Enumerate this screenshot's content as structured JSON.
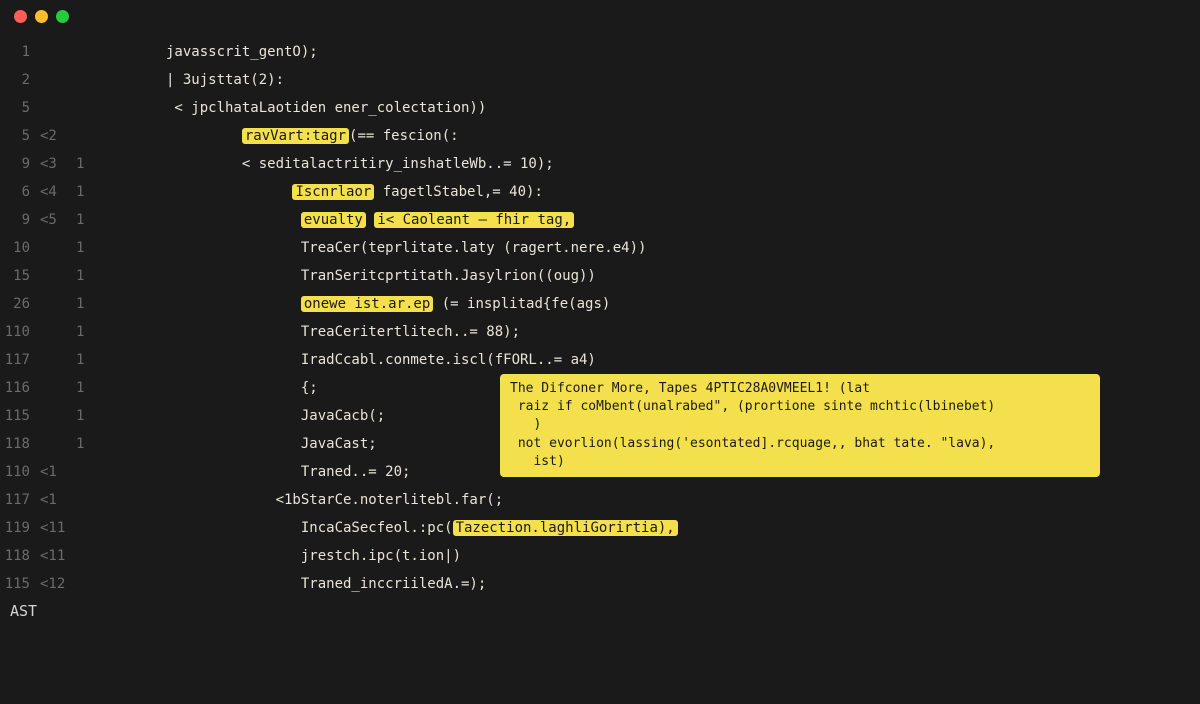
{
  "titlebar": {
    "buttons": [
      "close",
      "minimize",
      "zoom"
    ]
  },
  "lines": [
    {
      "ln": "1",
      "g2": "",
      "g3": "",
      "segs": [
        {
          "t": "javasscrit_gentO);"
        }
      ]
    },
    {
      "ln": "2",
      "g2": "",
      "g3": "",
      "segs": [
        {
          "t": "| "
        },
        {
          "t": "3ujsttat(2):"
        }
      ],
      "cursor": true
    },
    {
      "ln": "5",
      "g2": "",
      "g3": "",
      "segs": [
        {
          "t": " < jpclhataLaotiden ener_colectation))"
        }
      ]
    },
    {
      "ln": "5",
      "g2": "<2",
      "g3": "",
      "segs": [
        {
          "t": "         "
        },
        {
          "t": "ravVart:tagr",
          "hl": true
        },
        {
          "t": "(== fescion(:"
        }
      ]
    },
    {
      "ln": "9",
      "g2": "<3",
      "g3": "1",
      "segs": [
        {
          "t": "         < seditalactritiry_inshatleWb..= 10);"
        }
      ]
    },
    {
      "ln": "6",
      "g2": "<4",
      "g3": "1",
      "segs": [
        {
          "t": "               "
        },
        {
          "t": "Iscnrlaor",
          "hl": true
        },
        {
          "t": " fagetlStabel,= 40):"
        }
      ]
    },
    {
      "ln": "9",
      "g2": "<5",
      "g3": "1",
      "segs": [
        {
          "t": "                "
        },
        {
          "t": "evualty",
          "hl": true
        },
        {
          "t": " "
        },
        {
          "t": "i< Caoleant — fhir tag,",
          "hl": true
        }
      ]
    },
    {
      "ln": "10",
      "g2": "",
      "g3": "1",
      "segs": [
        {
          "t": "                TreaCer(teprlitate.laty (ragert.nere.e4))"
        }
      ]
    },
    {
      "ln": "15",
      "g2": "",
      "g3": "1",
      "segs": [
        {
          "t": "                TranSeritcprtitath.Jasylrion((oug))"
        }
      ]
    },
    {
      "ln": "26",
      "g2": "",
      "g3": "1",
      "segs": [
        {
          "t": "                "
        },
        {
          "t": "onewe ist.ar.ep",
          "hl": true
        },
        {
          "t": " (= insplitad{fe(ags)"
        }
      ]
    },
    {
      "ln": "110",
      "g2": "",
      "g3": "1",
      "segs": [
        {
          "t": "                TreaCeritertlitech..= 88);"
        }
      ]
    },
    {
      "ln": "117",
      "g2": "",
      "g3": "1",
      "segs": [
        {
          "t": "                IradCcabl.conmete.iscl(fFORL..= a4)"
        }
      ]
    },
    {
      "ln": "116",
      "g2": "",
      "g3": "1",
      "segs": [
        {
          "t": "                {;"
        }
      ]
    },
    {
      "ln": "115",
      "g2": "",
      "g3": "1",
      "segs": [
        {
          "t": "                JavaCacb(;"
        }
      ]
    },
    {
      "ln": "118",
      "g2": "",
      "g3": "1",
      "segs": [
        {
          "t": "                JavaCast;"
        }
      ]
    },
    {
      "ln": "110",
      "g2": "<1",
      "g3": "",
      "segs": [
        {
          "t": "                Traned..= 20;"
        }
      ]
    },
    {
      "ln": "117",
      "g2": "<1",
      "g3": "",
      "segs": [
        {
          "t": "             <1bStarCe.noterlitebl.far(;"
        }
      ]
    },
    {
      "ln": "119",
      "g2": "<11",
      "g3": "",
      "segs": [
        {
          "t": "                IncaCaSecfeol.:pc("
        },
        {
          "t": "Tazection.laghliGorirtia),",
          "hl": true
        }
      ]
    },
    {
      "ln": "118",
      "g2": "<11",
      "g3": "",
      "segs": [
        {
          "t": "                jrestch.ipc(t.ion|)"
        }
      ]
    },
    {
      "ln": "115",
      "g2": "<12",
      "g3": "",
      "segs": [
        {
          "t": "                Traned_inccriiledA.=);"
        }
      ]
    }
  ],
  "tooltip": {
    "line1": "The Difconer More, Tapes 4PTIC28A0VMEEL1! (lat",
    "line2": " raiz if coMbent(unalrabed\", (prortione sinte mchtic(lbinebet)\n   )",
    "line3": " not evorlion(lassing('esontated].rcquage,, bhat tate. \"lava),\n   ist)"
  },
  "bottom": "AST"
}
